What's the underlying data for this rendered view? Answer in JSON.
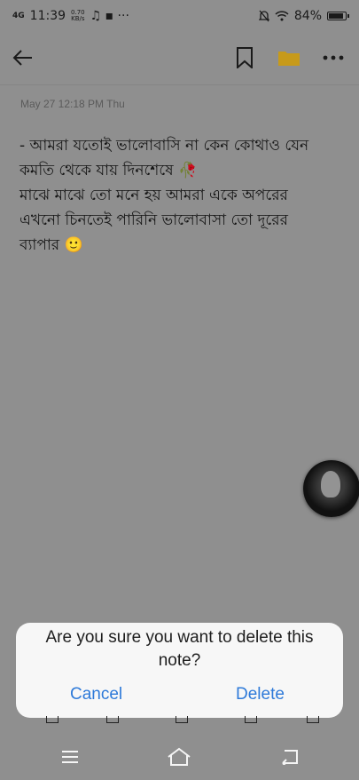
{
  "status": {
    "network": "4G",
    "time": "11:39",
    "speed_value": "0.70",
    "speed_unit": "KB/s",
    "extra": "♫ ▪ ···",
    "battery": "84%"
  },
  "toolbar": {
    "back_icon": "arrow-left-icon",
    "bookmark_icon": "bookmark-icon",
    "folder_icon": "folder-icon",
    "more_icon": "more-icon"
  },
  "note": {
    "timestamp": "May 27 12:18 PM Thu",
    "body": "- আমরা যতোই ভালোবাসি না কেন কোথাও যেন\nকমতি থেকে যায় দিনশেষে 🥀\nমাঝে মাঝে তো মনে হয় আমরা একে অপরের\nএখনো চিনতেই পারিনি ভালোবাসা তো দূরের\nব্যাপার 🙂"
  },
  "dialog": {
    "message": "Are you sure you want to delete this note?",
    "cancel_label": "Cancel",
    "delete_label": "Delete"
  },
  "colors": {
    "overlay_bg": "#8f8f8f",
    "dialog_bg": "#f7f7f7",
    "accent": "#2e7ad9",
    "folder": "#c79a1a"
  }
}
